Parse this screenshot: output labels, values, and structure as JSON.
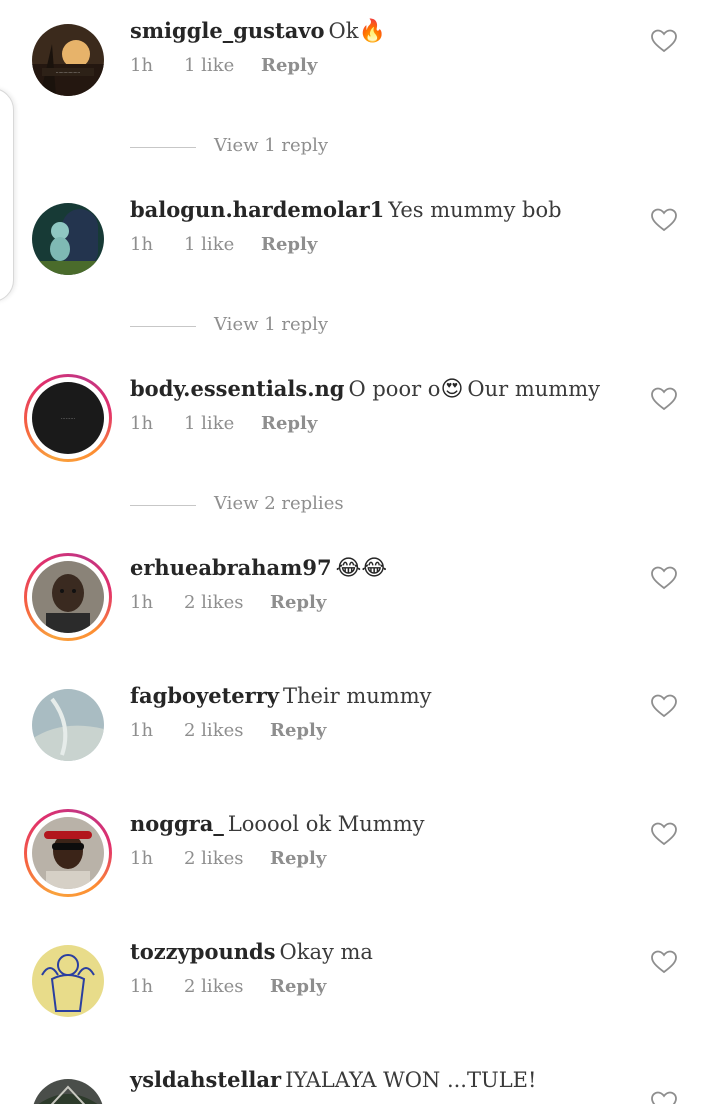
{
  "comments": [
    {
      "username": "smiggle_gustavo",
      "text": "Ok",
      "emoji": "🔥",
      "time": "1h",
      "likes": "1 like",
      "reply": "Reply",
      "avatar_icon": "sunset-photo-avatar",
      "story_ring": false
    },
    {
      "username": "balogun.hardemolar1",
      "text": "Yes mummy bob",
      "emoji": "",
      "time": "1h",
      "likes": "1 like",
      "reply": "Reply",
      "avatar_icon": "cartoon-avatar",
      "story_ring": false
    },
    {
      "username": "body.essentials.ng",
      "text": "O poor o",
      "emoji": "😍",
      "text_after": "Our mummy",
      "time": "1h",
      "likes": "1 like",
      "reply": "Reply",
      "avatar_icon": "brand-logo-avatar",
      "story_ring": true
    },
    {
      "username": "erhueabraham97",
      "text": "",
      "emoji": "😂😂",
      "time": "1h",
      "likes": "2 likes",
      "reply": "Reply",
      "avatar_icon": "person-photo-avatar",
      "story_ring": true
    },
    {
      "username": "fagboyeterry",
      "text": "Their mummy",
      "emoji": "",
      "time": "1h",
      "likes": "2 likes",
      "reply": "Reply",
      "avatar_icon": "sand-photo-avatar",
      "story_ring": false
    },
    {
      "username": "noggra_",
      "text": "Looool ok Mummy",
      "emoji": "",
      "time": "1h",
      "likes": "2 likes",
      "reply": "Reply",
      "avatar_icon": "sunglasses-person-avatar",
      "story_ring": true
    },
    {
      "username": "tozzypounds",
      "text": "Okay ma",
      "emoji": "",
      "time": "1h",
      "likes": "2 likes",
      "reply": "Reply",
      "avatar_icon": "illustration-avatar",
      "story_ring": false
    },
    {
      "username": "ysldahstellar",
      "text": "IYALAYA WON ...TULE!",
      "emoji": "",
      "time": "",
      "likes": "",
      "reply": "",
      "avatar_icon": "tree-photo-avatar",
      "story_ring": false
    }
  ],
  "view_replies": [
    {
      "label": "View 1 reply"
    },
    {
      "label": "View 1 reply"
    },
    {
      "label": "View 2 replies"
    }
  ],
  "colors": {
    "ring": "#e1306c",
    "secondary_text": "#8e8e8e",
    "primary_text": "#262626"
  }
}
